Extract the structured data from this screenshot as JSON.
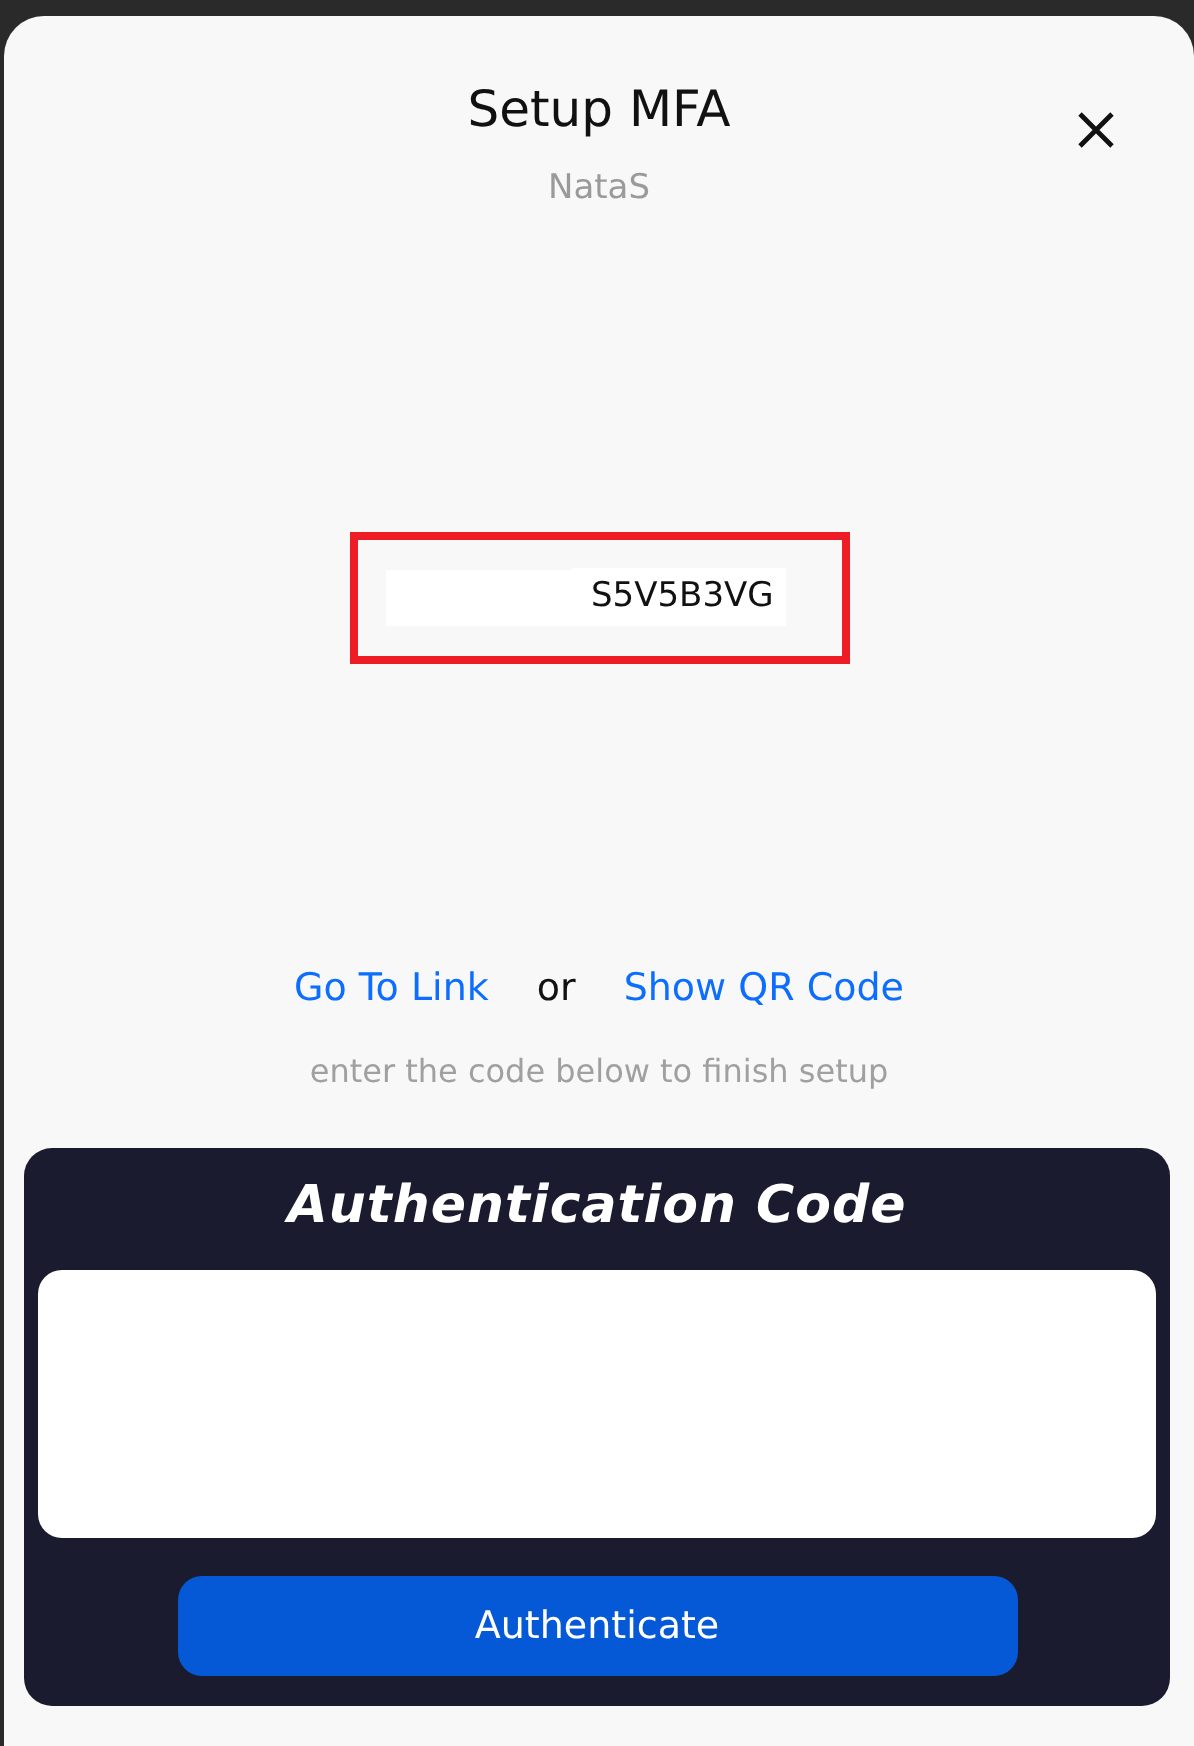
{
  "dialog": {
    "title": "Setup MFA",
    "subtitle": "NataS"
  },
  "secret": {
    "text": "S5V5B3VG",
    "redacted": true,
    "highlighted": true
  },
  "links": [
    {
      "kind": "link",
      "text": "Go To Link"
    },
    {
      "kind": "text",
      "text": "or"
    },
    {
      "kind": "link",
      "text": "Show QR Code"
    }
  ],
  "hint": "enter the code below to finish setup",
  "auth_panel": {
    "title": "Authentication Code",
    "button": "Authenticate"
  }
}
